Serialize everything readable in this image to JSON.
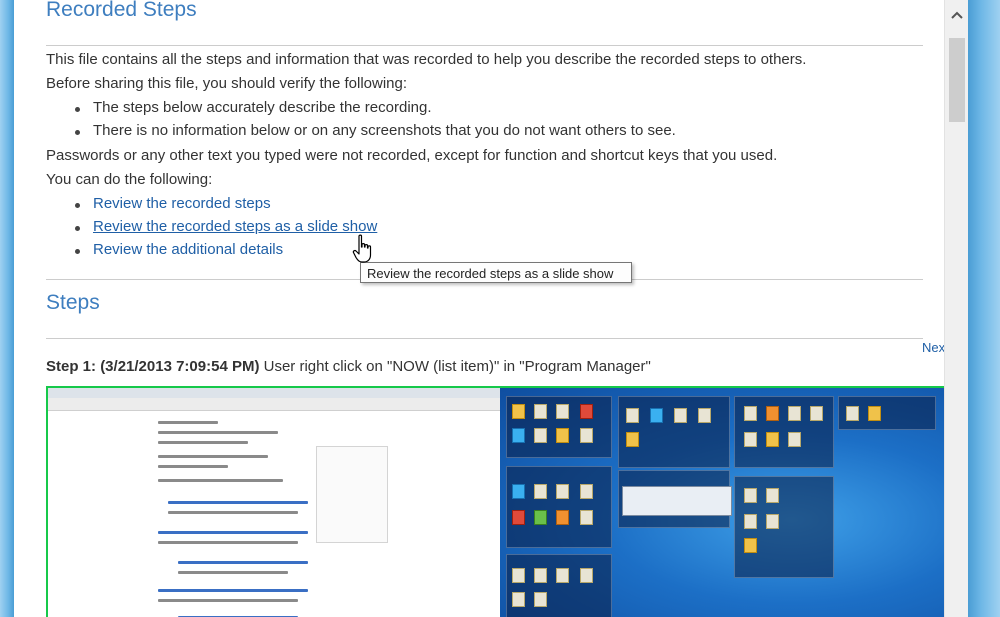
{
  "recorded_steps": {
    "title": "Recorded Steps",
    "intro": "This file contains all the steps and information that was recorded to help you describe the recorded steps to others.",
    "before_sharing": "Before sharing this file, you should verify the following:",
    "verify_items": [
      "The steps below accurately describe the recording.",
      "There is no information below or on any screenshots that you do not want others to see."
    ],
    "passwords_note": "Passwords or any other text you typed were not recorded, except for function and shortcut keys that you used.",
    "can_do": "You can do the following:",
    "links": [
      "Review the recorded steps",
      "Review the recorded steps as a slide show",
      "Review the additional details"
    ],
    "tooltip": "Review the recorded steps as a slide show"
  },
  "steps": {
    "title": "Steps",
    "next_label": "Next",
    "step1": {
      "label": "Step 1:",
      "timestamp": "(3/21/2013 7:09:54 PM)",
      "description": "User right click on \"NOW (list item)\" in \"Program Manager\""
    }
  },
  "colors": {
    "heading": "#3e7ebf",
    "link": "#1f5fa6",
    "screenshot_border": "#16c94a",
    "window_frame": "#6db7e6"
  },
  "icons": {
    "scroll_up": "chevron-up-icon",
    "cursor": "hand-pointer-icon"
  }
}
